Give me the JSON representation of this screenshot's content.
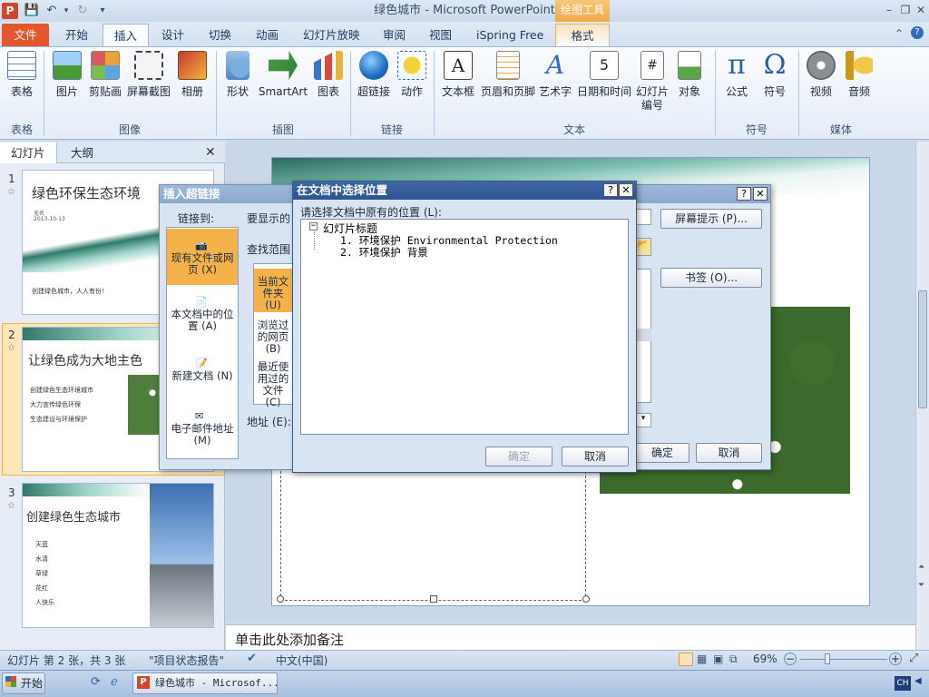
{
  "window": {
    "title": "绿色城市 - Microsoft PowerPoint",
    "context_tab_group": "绘图工具"
  },
  "app_logo": "P",
  "tabs": [
    "文件",
    "开始",
    "插入",
    "设计",
    "切换",
    "动画",
    "幻灯片放映",
    "审阅",
    "视图",
    "iSpring Free",
    "格式"
  ],
  "ribbon": {
    "buttons": [
      "表格",
      "图片",
      "剪贴画",
      "屏幕截图",
      "相册",
      "形状",
      "SmartArt",
      "图表",
      "超链接",
      "动作",
      "文本框",
      "页眉和页脚",
      "艺术字",
      "日期和时间",
      "幻灯片编号",
      "对象",
      "公式",
      "符号",
      "视频",
      "音频"
    ],
    "groups": [
      "表格",
      "图像",
      "插图",
      "链接",
      "文本",
      "符号",
      "媒体"
    ]
  },
  "slide_panel": {
    "tabs": [
      "幻灯片",
      "大纲"
    ],
    "thumbs": [
      {
        "num": "1",
        "title": "绿色环保生态环境",
        "sub1": "无名",
        "sub2": "2013-10-13",
        "footer": "创建绿色城市，人人有份！"
      },
      {
        "num": "2",
        "title": "让绿色成为大地主色",
        "bullets": [
          "创建绿色生态环境城市",
          "大力宣传绿色环保",
          "生态建设与环境保护"
        ]
      },
      {
        "num": "3",
        "title": "创建绿色生态城市",
        "bullets": [
          "天蓝",
          "水清",
          "草绿",
          "花红",
          "人快乐"
        ]
      }
    ]
  },
  "notes_placeholder": "单击此处添加备注",
  "hyperlink_dialog": {
    "title": "插入超链接",
    "link_to_label": "链接到:",
    "display_text_label": "要显示的",
    "look_in_label": "查找范围",
    "address_label": "地址 (E):",
    "link_types": [
      "现有文件或网页 (X)",
      "本文档中的位置 (A)",
      "新建文档 (N)",
      "电子邮件地址 (M)"
    ],
    "browse_items": [
      "当前文件夹 (U)",
      "浏览过的网页 (B)",
      "最近使用过的文件 (C)"
    ],
    "screen_tip_button": "屏幕提示 (P)...",
    "bookmark_button": "书签 (O)...",
    "ok_button": "确定",
    "cancel_button": "取消"
  },
  "select_place_dialog": {
    "title": "在文档中选择位置",
    "prompt": "请选择文档中原有的位置 (L):",
    "tree_root": "幻灯片标题",
    "tree_items": [
      "1. 环境保护 Environmental Protection",
      "2. 环境保护    背景"
    ],
    "ok_button": "确定",
    "cancel_button": "取消"
  },
  "status": {
    "slide_info": "幻灯片 第 2 张，共 3 张",
    "theme": "\"项目状态报告\"",
    "language": "中文(中国)",
    "zoom": "69%"
  },
  "taskbar": {
    "start": "开始",
    "task": "绿色城市 - Microsof...",
    "ime": "CH"
  },
  "colors": {
    "accent_file": "#e4572e",
    "context": "#f0a947",
    "selection": "#f6b24a"
  }
}
